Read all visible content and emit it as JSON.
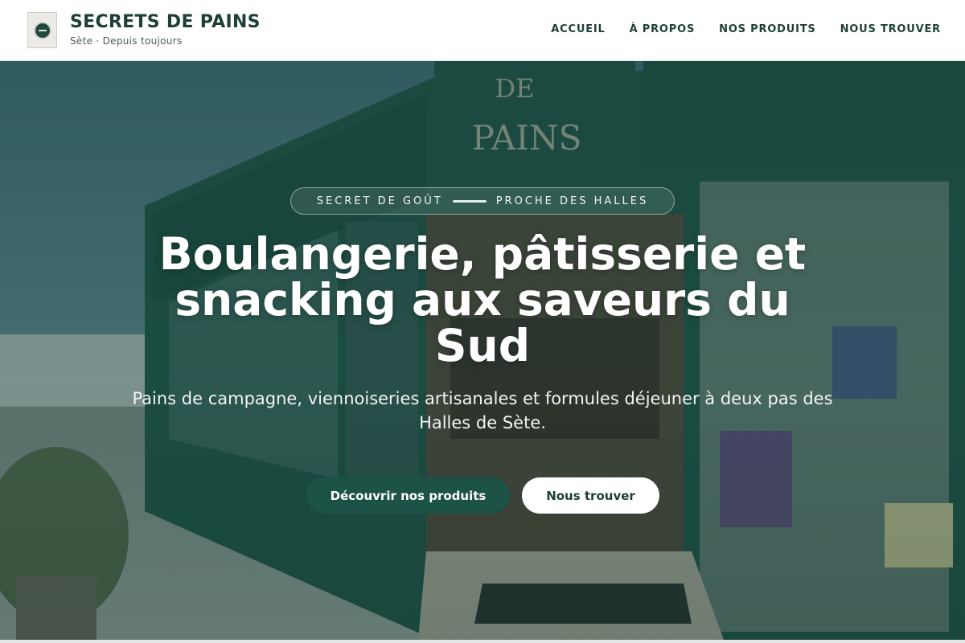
{
  "header": {
    "brand_title": "SECRETS DE PAINS",
    "brand_subtitle": "Sète · Depuis toujours",
    "nav": [
      "ACCUEIL",
      "À PROPOS",
      "NOS PRODUITS",
      "NOUS TROUVER"
    ]
  },
  "hero": {
    "eyebrow_left": "SECRET DE GOÛT",
    "eyebrow_right": "PROCHE DES HALLES",
    "title": "Boulangerie, pâtisserie et snacking aux saveurs du Sud",
    "lead": "Pains de campagne, viennoiseries artisanales et formules déjeuner à deux pas des Halles de Sète.",
    "primary_cta": "Découvrir nos produits",
    "secondary_cta": "Nous trouver"
  },
  "colors": {
    "brand_green": "#1d5246",
    "header_bg": "#ffffff",
    "text_dark": "#1d3f37"
  }
}
